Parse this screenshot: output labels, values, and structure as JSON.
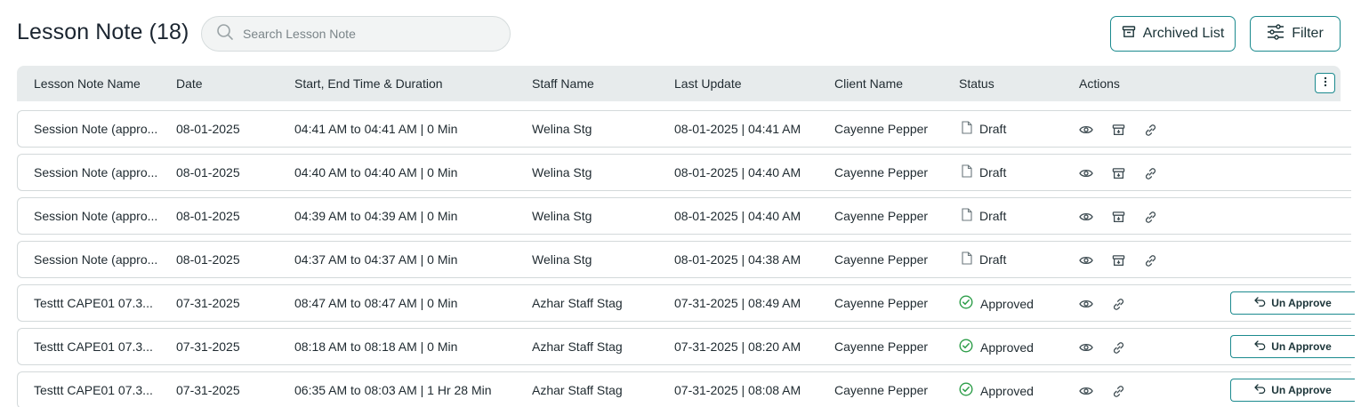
{
  "header": {
    "title": "Lesson Note (18)",
    "search_placeholder": "Search Lesson Note",
    "archived_label": "Archived List",
    "filter_label": "Filter"
  },
  "colors": {
    "accent": "#1b8a8e",
    "approved": "#2e9e4a",
    "header_bg": "#e7ebec"
  },
  "table": {
    "columns": [
      "Lesson Note Name",
      "Date",
      "Start, End Time & Duration",
      "Staff Name",
      "Last Update",
      "Client Name",
      "Status",
      "Actions"
    ],
    "rows": [
      {
        "name": "Session Note (appro...",
        "date": "08-01-2025",
        "time": "04:41 AM to 04:41 AM | 0 Min",
        "staff": "Welina Stg",
        "updated": "08-01-2025 | 04:41 AM",
        "client": "Cayenne Pepper",
        "status": "Draft",
        "action_label": ""
      },
      {
        "name": "Session Note (appro...",
        "date": "08-01-2025",
        "time": "04:40 AM to 04:40 AM | 0 Min",
        "staff": "Welina Stg",
        "updated": "08-01-2025 | 04:40 AM",
        "client": "Cayenne Pepper",
        "status": "Draft",
        "action_label": ""
      },
      {
        "name": "Session Note (appro...",
        "date": "08-01-2025",
        "time": "04:39 AM to 04:39 AM | 0 Min",
        "staff": "Welina Stg",
        "updated": "08-01-2025 | 04:40 AM",
        "client": "Cayenne Pepper",
        "status": "Draft",
        "action_label": ""
      },
      {
        "name": "Session Note (appro...",
        "date": "08-01-2025",
        "time": "04:37 AM to 04:37 AM | 0 Min",
        "staff": "Welina Stg",
        "updated": "08-01-2025 | 04:38 AM",
        "client": "Cayenne Pepper",
        "status": "Draft",
        "action_label": ""
      },
      {
        "name": "Testtt CAPE01 07.3...",
        "date": "07-31-2025",
        "time": "08:47 AM to 08:47 AM | 0 Min",
        "staff": "Azhar Staff Stag",
        "updated": "07-31-2025 | 08:49 AM",
        "client": "Cayenne Pepper",
        "status": "Approved",
        "action_label": "Un Approve"
      },
      {
        "name": "Testtt CAPE01 07.3...",
        "date": "07-31-2025",
        "time": "08:18 AM to 08:18 AM | 0 Min",
        "staff": "Azhar Staff Stag",
        "updated": "07-31-2025 | 08:20 AM",
        "client": "Cayenne Pepper",
        "status": "Approved",
        "action_label": "Un Approve"
      },
      {
        "name": "Testtt CAPE01 07.3...",
        "date": "07-31-2025",
        "time": "06:35 AM to 08:03 AM | 1 Hr 28 Min",
        "staff": "Azhar Staff Stag",
        "updated": "07-31-2025 | 08:08 AM",
        "client": "Cayenne Pepper",
        "status": "Approved",
        "action_label": "Un Approve"
      }
    ]
  }
}
